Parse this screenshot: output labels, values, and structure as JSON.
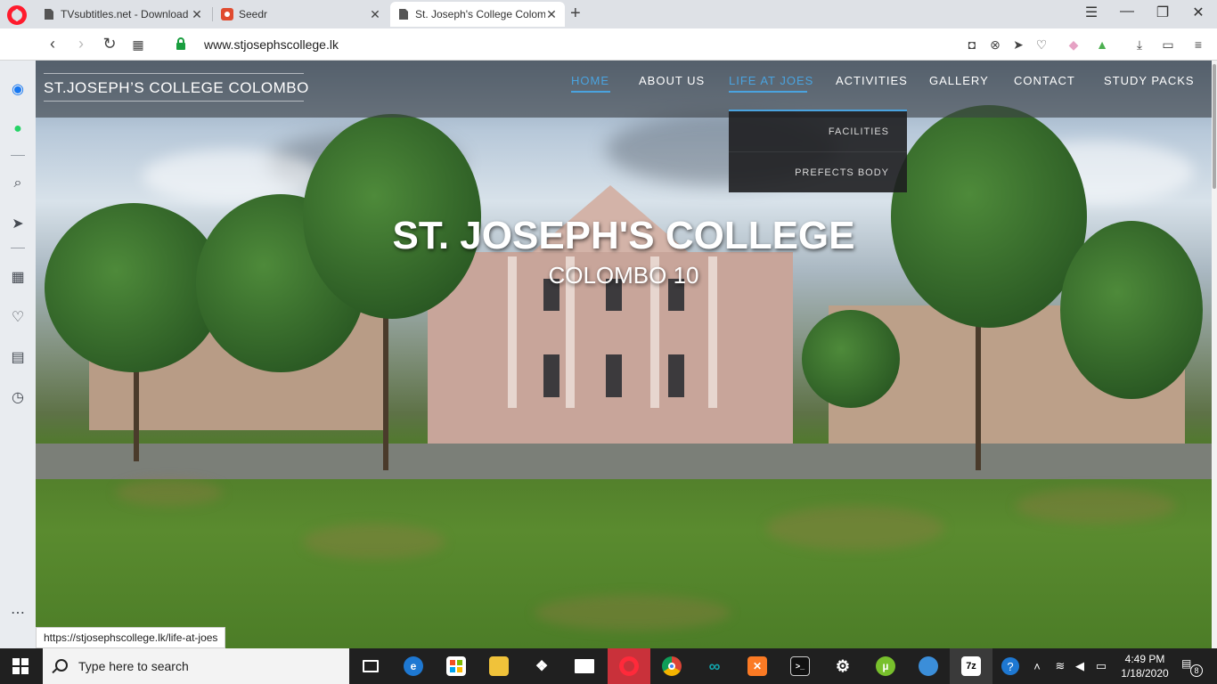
{
  "browser": {
    "tabs": [
      {
        "title": "TVsubtitles.net - Download",
        "icon": "document-icon",
        "active": false
      },
      {
        "title": "Seedr",
        "icon": "seedr-icon",
        "active": false
      },
      {
        "title": "St. Joseph's College Colombo",
        "icon": "document-icon",
        "active": true
      }
    ],
    "new_tab": "+",
    "url": "www.stjosephscollege.lk",
    "status_url": "https://stjosephscollege.lk/life-at-joes"
  },
  "site": {
    "logo": "ST.JOSEPH’S COLLEGE  COLOMBO",
    "nav": [
      {
        "label": "HOME",
        "state": "active"
      },
      {
        "label": "ABOUT US",
        "state": "normal"
      },
      {
        "label": "LIFE AT JOES",
        "state": "hover"
      },
      {
        "label": "ACTIVITIES",
        "state": "normal"
      },
      {
        "label": "GALLERY",
        "state": "normal"
      },
      {
        "label": "CONTACT",
        "state": "normal"
      },
      {
        "label": "STUDY PACKS",
        "state": "normal"
      }
    ],
    "dropdown": [
      "FACILITIES",
      "PREFECTS BODY"
    ],
    "hero_title": "ST. JOSEPH'S COLLEGE",
    "hero_subtitle": "COLOMBO 10",
    "accent": "#4aa3df"
  },
  "taskbar": {
    "search_placeholder": "Type here to search",
    "time": "4:49 PM",
    "date": "1/18/2020",
    "notification_count": "8",
    "apps": [
      "task-view-icon",
      "edge-icon",
      "store-icon",
      "file-explorer-icon",
      "dropbox-icon",
      "mail-icon",
      "opera-icon",
      "chrome-icon",
      "arduino-icon",
      "xampp-icon",
      "terminal-icon",
      "settings-icon",
      "utorrent-icon",
      "network-app-icon",
      "7zip-icon"
    ],
    "app_7zip_label": "7z",
    "help_label": "?"
  }
}
